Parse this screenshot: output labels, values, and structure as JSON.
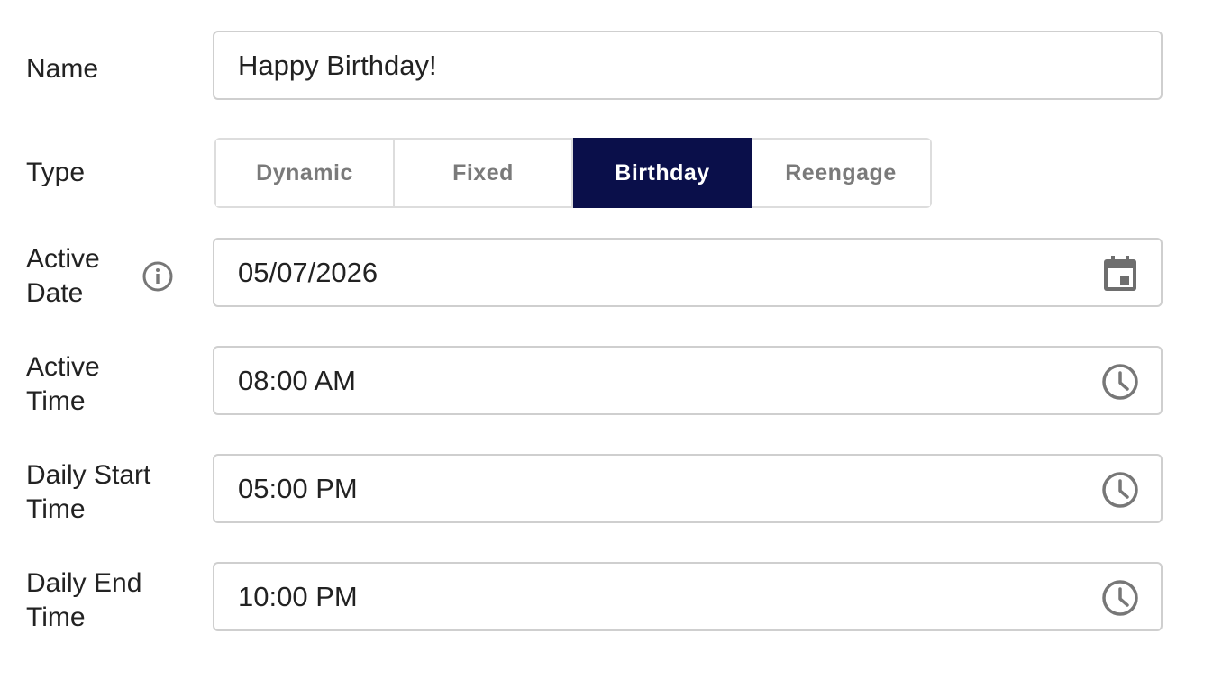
{
  "form": {
    "name": {
      "label": "Name",
      "value": "Happy Birthday!"
    },
    "type": {
      "label": "Type",
      "options": [
        "Dynamic",
        "Fixed",
        "Birthday",
        "Reengage"
      ],
      "selected": "Birthday",
      "active_color": "#0a0f4a"
    },
    "active_date": {
      "label_line1": "Active",
      "label_line2": "Date",
      "info_icon": "info-circle-icon",
      "value": "05/07/2026",
      "trailing_icon": "calendar-icon"
    },
    "active_time": {
      "label_line1": "Active",
      "label_line2": "Time",
      "value": "08:00 AM",
      "trailing_icon": "clock-icon"
    },
    "daily_start_time": {
      "label_line1": "Daily Start",
      "label_line2": "Time",
      "value": "05:00 PM",
      "trailing_icon": "clock-icon"
    },
    "daily_end_time": {
      "label_line1": "Daily End",
      "label_line2": "Time",
      "value": "10:00 PM",
      "trailing_icon": "clock-icon"
    }
  }
}
